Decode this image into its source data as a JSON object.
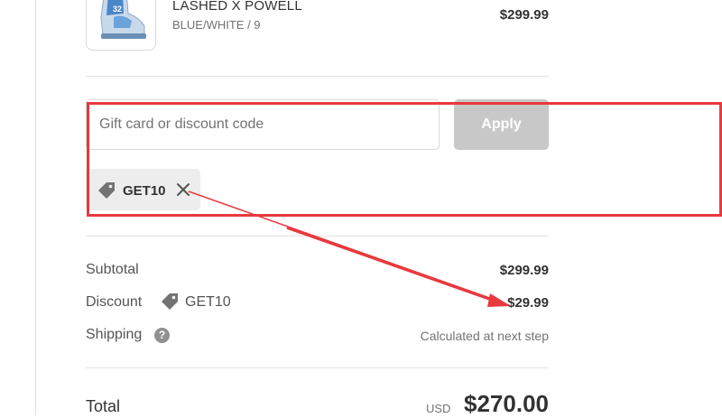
{
  "product": {
    "name": "LASHED X POWELL",
    "variant": "BLUE/WHITE / 9",
    "price": "$299.99",
    "thumbnail_icon": "snowboard-boot-image"
  },
  "discount_form": {
    "placeholder": "Gift card or discount code",
    "value": "",
    "apply_label": "Apply",
    "applied_code": "GET10",
    "tag_icon": "tag-icon",
    "remove_icon": "close-icon"
  },
  "summary": {
    "subtotal_label": "Subtotal",
    "subtotal_value": "$299.99",
    "discount_label": "Discount",
    "discount_code": "GET10",
    "discount_value": "$29.99",
    "shipping_label": "Shipping",
    "shipping_help": "?",
    "shipping_value": "Calculated at next step",
    "total_label": "Total",
    "total_currency": "USD",
    "total_value": "$270.00"
  },
  "colors": {
    "annotation_red": "#e8393d",
    "apply_disabled": "#c8c8c8",
    "chip_bg": "#ededed",
    "text_primary": "#323232",
    "text_secondary": "#737373"
  }
}
